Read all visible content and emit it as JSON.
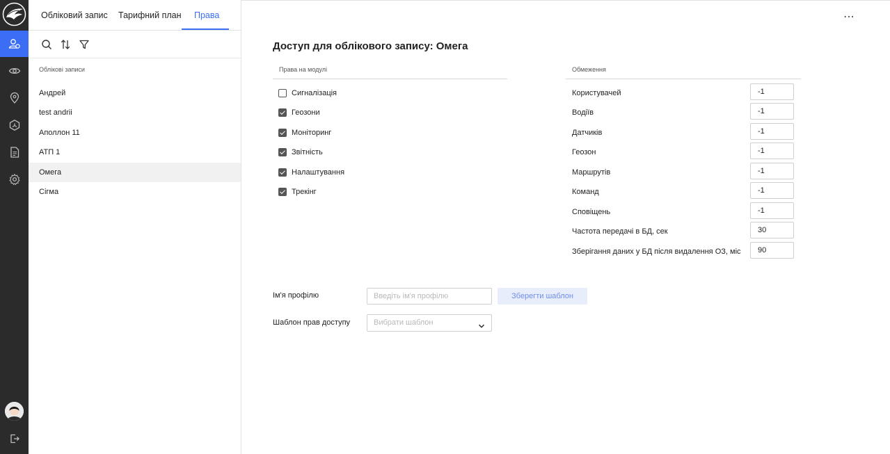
{
  "tabs": [
    {
      "label": "Обліковий запис"
    },
    {
      "label": "Тарифний план"
    },
    {
      "label": "Права"
    }
  ],
  "accounts": {
    "title": "Облікові записи",
    "items": [
      {
        "label": "Андрей"
      },
      {
        "label": "test andrii"
      },
      {
        "label": "Аполлон 11"
      },
      {
        "label": "АТП 1"
      },
      {
        "label": "Омега"
      },
      {
        "label": "Сігма"
      }
    ],
    "selected": "Омега"
  },
  "main": {
    "title": "Доступ для облікового запису: Омега",
    "permissions_header": "Права на модулі",
    "limits_header": "Обмеження",
    "permissions": [
      {
        "label": "Сигналізація",
        "checked": false
      },
      {
        "label": "Геозони",
        "checked": true
      },
      {
        "label": "Моніторинг",
        "checked": true
      },
      {
        "label": "Звітність",
        "checked": true
      },
      {
        "label": "Налаштування",
        "checked": true
      },
      {
        "label": "Трекінг",
        "checked": true
      }
    ],
    "limits": [
      {
        "label": "Користувачей",
        "value": "-1"
      },
      {
        "label": "Водіїв",
        "value": "-1"
      },
      {
        "label": "Датчиків",
        "value": "-1"
      },
      {
        "label": "Геозон",
        "value": "-1"
      },
      {
        "label": "Маршрутів",
        "value": "-1"
      },
      {
        "label": "Команд",
        "value": "-1"
      },
      {
        "label": "Сповіщень",
        "value": "-1"
      },
      {
        "label": "Частота передачі в БД, сек",
        "value": "30"
      },
      {
        "label": "Зберігання даних у БД після видалення ОЗ, міс",
        "value": "90"
      }
    ],
    "profile_label": "Ім'я профілю",
    "profile_placeholder": "Введіть ім'я профілю",
    "save_template": "Зберегти шаблон",
    "template_label": "Шаблон прав доступу",
    "template_placeholder": "Вибрати шаблон"
  },
  "colors": {
    "accent": "#3b6ef5",
    "rail": "#2b2b2b",
    "selected_row": "#f1f1f1"
  }
}
